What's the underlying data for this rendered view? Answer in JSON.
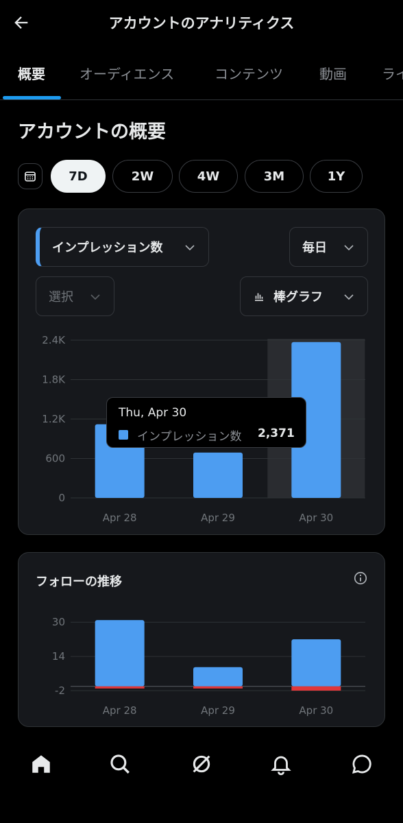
{
  "header": {
    "title": "アカウントのアナリティクス"
  },
  "tabs": [
    {
      "label": "概要",
      "active": true
    },
    {
      "label": "オーディエンス",
      "active": false
    },
    {
      "label": "コンテンツ",
      "active": false
    },
    {
      "label": "動画",
      "active": false
    },
    {
      "label": "ライ",
      "active": false
    }
  ],
  "overview": {
    "title": "アカウントの概要",
    "ranges": [
      {
        "label": "7D",
        "active": true
      },
      {
        "label": "2W",
        "active": false
      },
      {
        "label": "4W",
        "active": false
      },
      {
        "label": "3M",
        "active": false
      },
      {
        "label": "1Y",
        "active": false
      }
    ]
  },
  "controls": {
    "metric": "インプレッション数",
    "interval": "毎日",
    "compare": "選択",
    "chart_type": "棒グラフ"
  },
  "tooltip": {
    "date": "Thu, Apr 30",
    "series": "インプレッション数",
    "value": "2,371"
  },
  "follow_card": {
    "title": "フォローの推移"
  },
  "colors": {
    "accent": "#4d9df1",
    "negative": "#e0373a",
    "highlight": "#2a2c30"
  },
  "chart_data": [
    {
      "type": "bar",
      "categories": [
        "Apr 28",
        "Apr 29",
        "Apr 30"
      ],
      "series": [
        {
          "name": "インプレッション数",
          "values": [
            1120,
            690,
            2371
          ]
        }
      ],
      "yticks": [
        "0",
        "600",
        "1.2K",
        "1.8K",
        "2.4K"
      ],
      "ytick_values": [
        0,
        600,
        1200,
        1800,
        2400
      ],
      "ylim": [
        0,
        2400
      ],
      "highlighted_category": "Apr 30",
      "grid": true
    },
    {
      "type": "bar",
      "categories": [
        "Apr 28",
        "Apr 29",
        "Apr 30"
      ],
      "series": [
        {
          "values": [
            31,
            9,
            22
          ]
        },
        {
          "values": [
            -1,
            -1,
            -2
          ]
        }
      ],
      "yticks": [
        "-2",
        "14",
        "30"
      ],
      "ytick_values": [
        -2,
        14,
        30
      ],
      "ylim": [
        -2,
        32
      ],
      "grid": true
    }
  ]
}
